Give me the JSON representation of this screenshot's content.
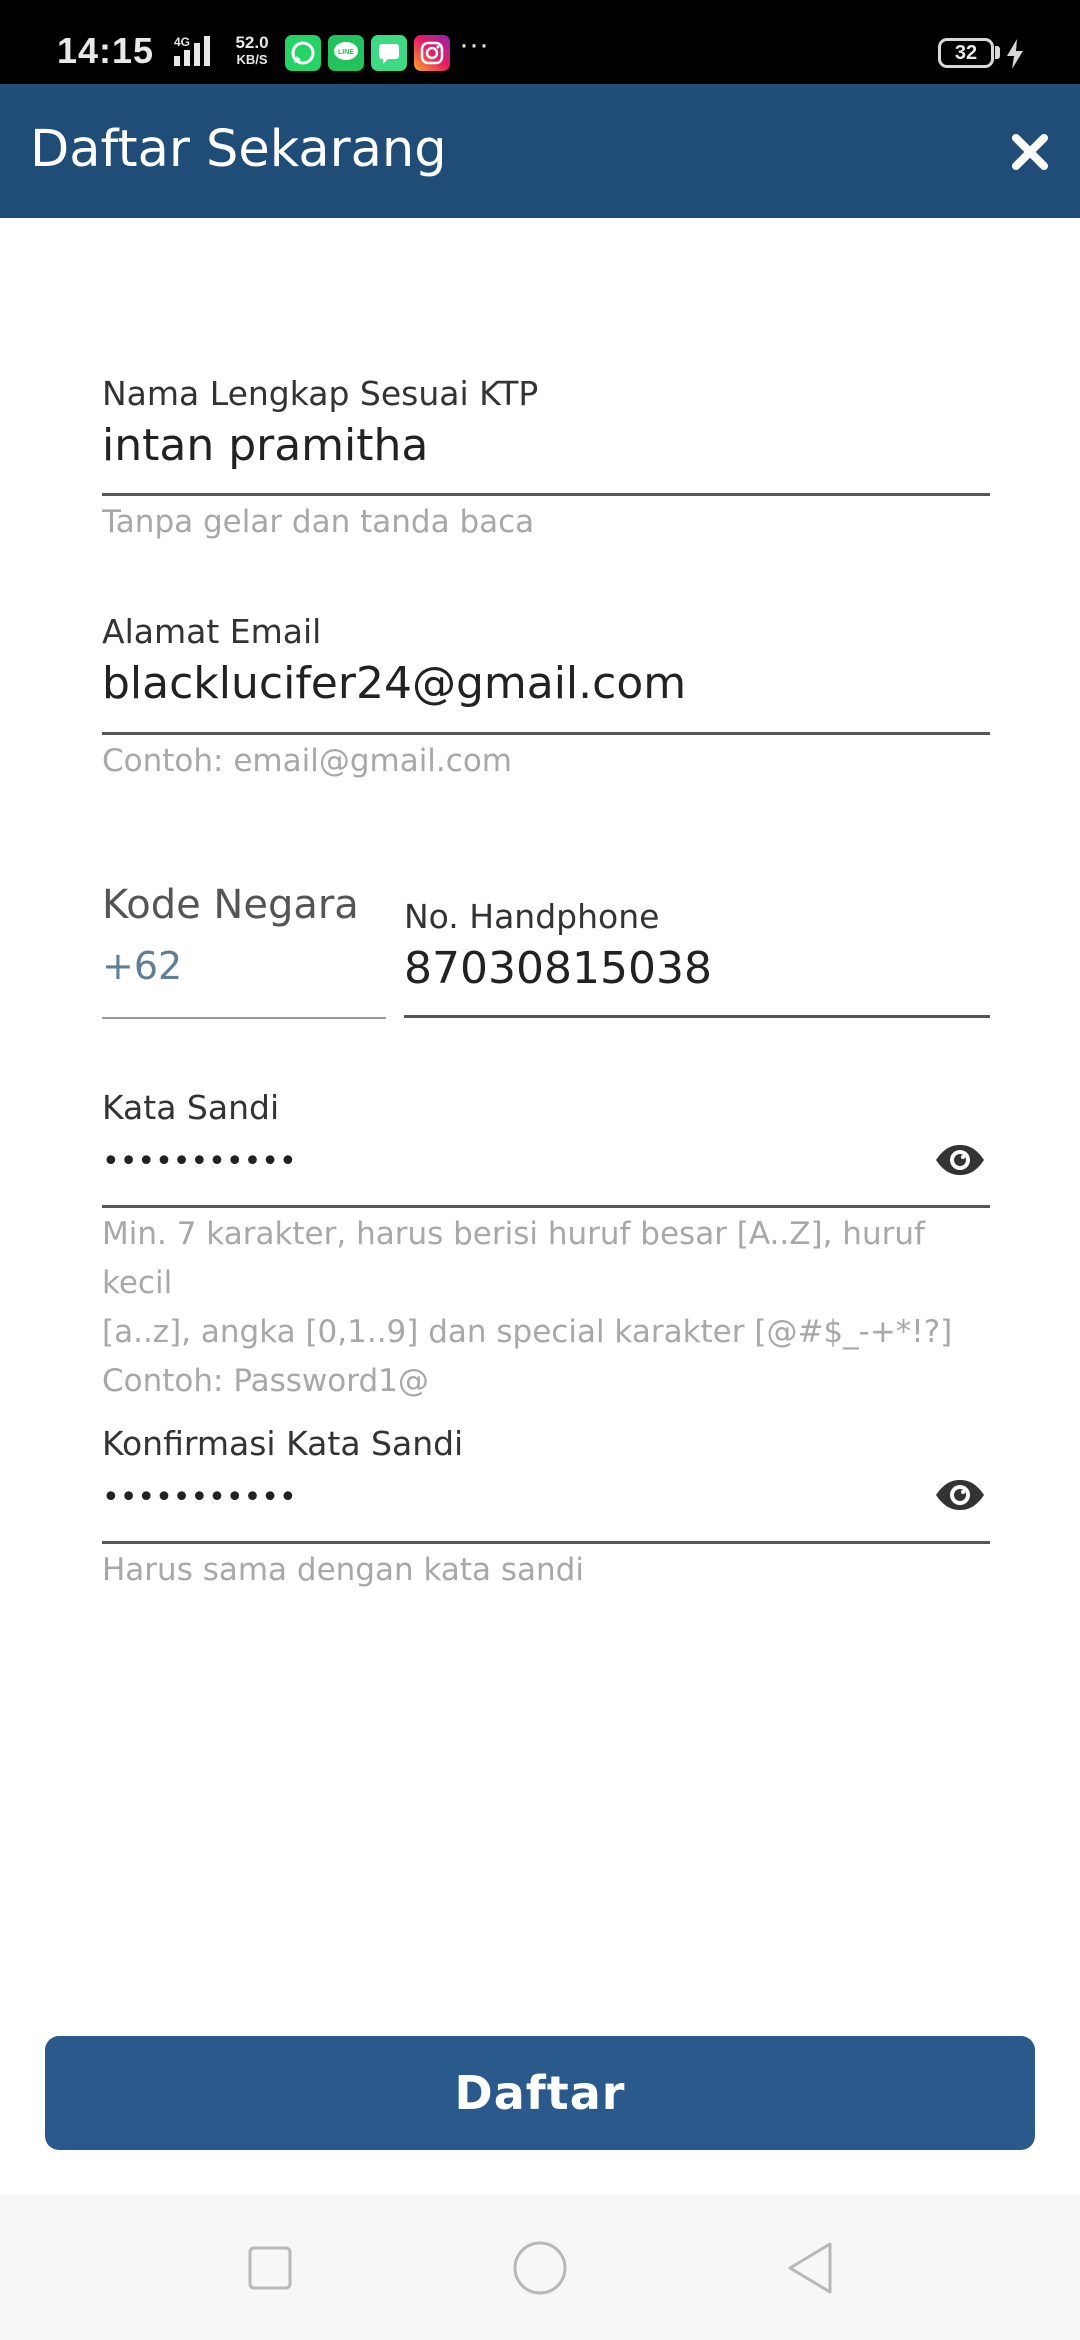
{
  "status_bar": {
    "time": "14:15",
    "network": "4G",
    "speed_value": "52.0",
    "speed_unit": "KB/S",
    "battery": "32",
    "apps": [
      "whatsapp-icon",
      "line-icon",
      "messages-icon",
      "instagram-icon"
    ]
  },
  "app_bar": {
    "title": "Daftar Sekarang",
    "bg_color": "#1f4d78"
  },
  "form": {
    "full_name": {
      "label": "Nama Lengkap Sesuai KTP",
      "value": "intan pramitha",
      "hint": "Tanpa gelar dan tanda baca"
    },
    "email": {
      "label": "Alamat Email",
      "value": "blacklucifer24@gmail.com",
      "hint": "Contoh: email@gmail.com"
    },
    "country_code": {
      "label": "Kode Negara",
      "value": "+62"
    },
    "phone": {
      "label": "No. Handphone",
      "value": "87030815038"
    },
    "password": {
      "label": "Kata Sandi",
      "value": "•••••••••••",
      "hint_line1": "Min. 7 karakter, harus berisi huruf besar [A..Z], huruf kecil",
      "hint_line2": "[a..z], angka [0,1..9] dan special karakter [@#$_-+*!?]",
      "hint_line3": "Contoh: Password1@"
    },
    "confirm_password": {
      "label": "Konfirmasi Kata Sandi",
      "value": "•••••••••••",
      "hint": "Harus sama dengan kata sandi"
    }
  },
  "submit_button": {
    "label": "Daftar",
    "color": "#2a5a8c"
  }
}
